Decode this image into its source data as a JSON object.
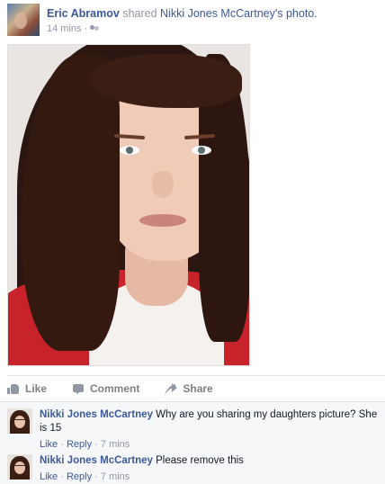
{
  "post": {
    "author": "Eric Abramov",
    "shared_text": "shared",
    "source_name": "Nikki Jones McCartney's",
    "object_text": "photo.",
    "timestamp": "14 mins",
    "separator": "·",
    "audience_icon": "friends-icon"
  },
  "photo": {
    "description_icon": "photo"
  },
  "actions": {
    "like": "Like",
    "comment": "Comment",
    "share": "Share"
  },
  "comments": [
    {
      "author": "Nikki Jones McCartney",
      "text": "Why are you sharing my daughters picture? She is 15",
      "like": "Like",
      "reply": "Reply",
      "time": "7 mins",
      "sep": "·"
    },
    {
      "author": "Nikki Jones McCartney",
      "text": "Please remove this",
      "like": "Like",
      "reply": "Reply",
      "time": "7 mins",
      "sep": "·"
    }
  ],
  "colors": {
    "link": "#3b5998",
    "muted": "#9197a3",
    "comments_bg": "#f6f7f9"
  }
}
